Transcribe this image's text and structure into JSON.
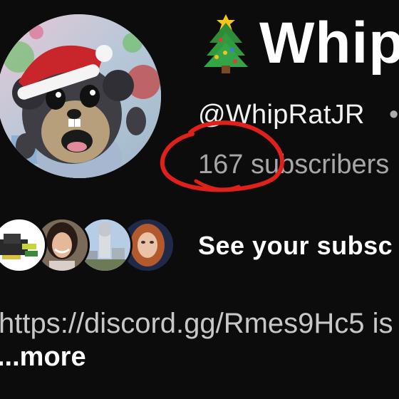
{
  "channel": {
    "title_emoji": "🎄",
    "name": "Whip",
    "handle": "@WhipRatJR",
    "handle_separator": "•",
    "subscribers": "167 subscribers"
  },
  "icons": {
    "avatar": "rat-santa-avatar",
    "title_emoji": "christmas-tree-icon"
  },
  "subscriber_preview": {
    "label": "See your subsc",
    "avatars": [
      "tools-avatar",
      "woman-avatar",
      "building-avatar",
      "redhead-avatar"
    ]
  },
  "description": {
    "text": "https://discord.gg/Rmes9Hc5 is",
    "more_label": "...more"
  },
  "annotation": {
    "color": "#e0201a"
  }
}
